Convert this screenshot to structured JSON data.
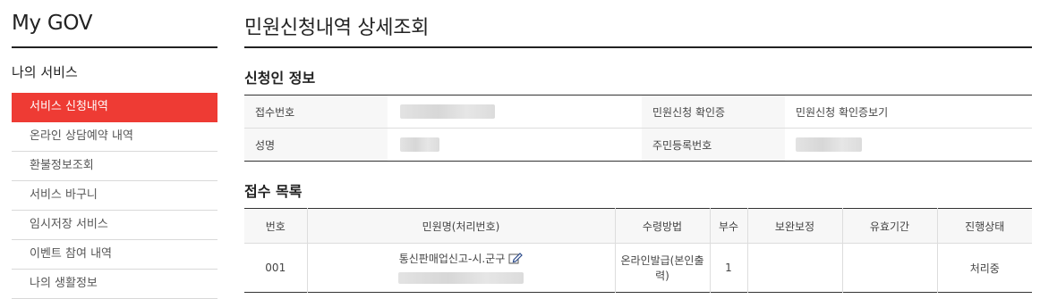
{
  "sidebar": {
    "brand": "My GOV",
    "section_title": "나의 서비스",
    "items": [
      {
        "label": "서비스 신청내역",
        "active": true
      },
      {
        "label": "온라인 상담예약 내역",
        "active": false
      },
      {
        "label": "환불정보조회",
        "active": false
      },
      {
        "label": "서비스 바구니",
        "active": false
      },
      {
        "label": "임시저장 서비스",
        "active": false
      },
      {
        "label": "이벤트 참여 내역",
        "active": false
      },
      {
        "label": "나의 생활정보",
        "active": false
      }
    ]
  },
  "main": {
    "page_title": "민원신청내역 상세조회",
    "applicant": {
      "title": "신청인 정보",
      "receipt_no_label": "접수번호",
      "confirm_label": "민원신청 확인증",
      "confirm_link": "민원신청 확인증보기",
      "name_label": "성명",
      "rrn_label": "주민등록번호"
    },
    "receipts": {
      "title": "접수 목록",
      "headers": [
        "번호",
        "민원명(처리번호)",
        "수령방법",
        "부수",
        "보완보정",
        "유효기간",
        "진행상태"
      ],
      "rows": [
        {
          "no": "001",
          "name": "통신판매업신고-시.군구",
          "method": "온라인발급(본인출력)",
          "copies": "1",
          "supplement": "",
          "validity": "",
          "status": "처리중"
        }
      ]
    }
  },
  "colors": {
    "accent": "#ee3b34"
  }
}
